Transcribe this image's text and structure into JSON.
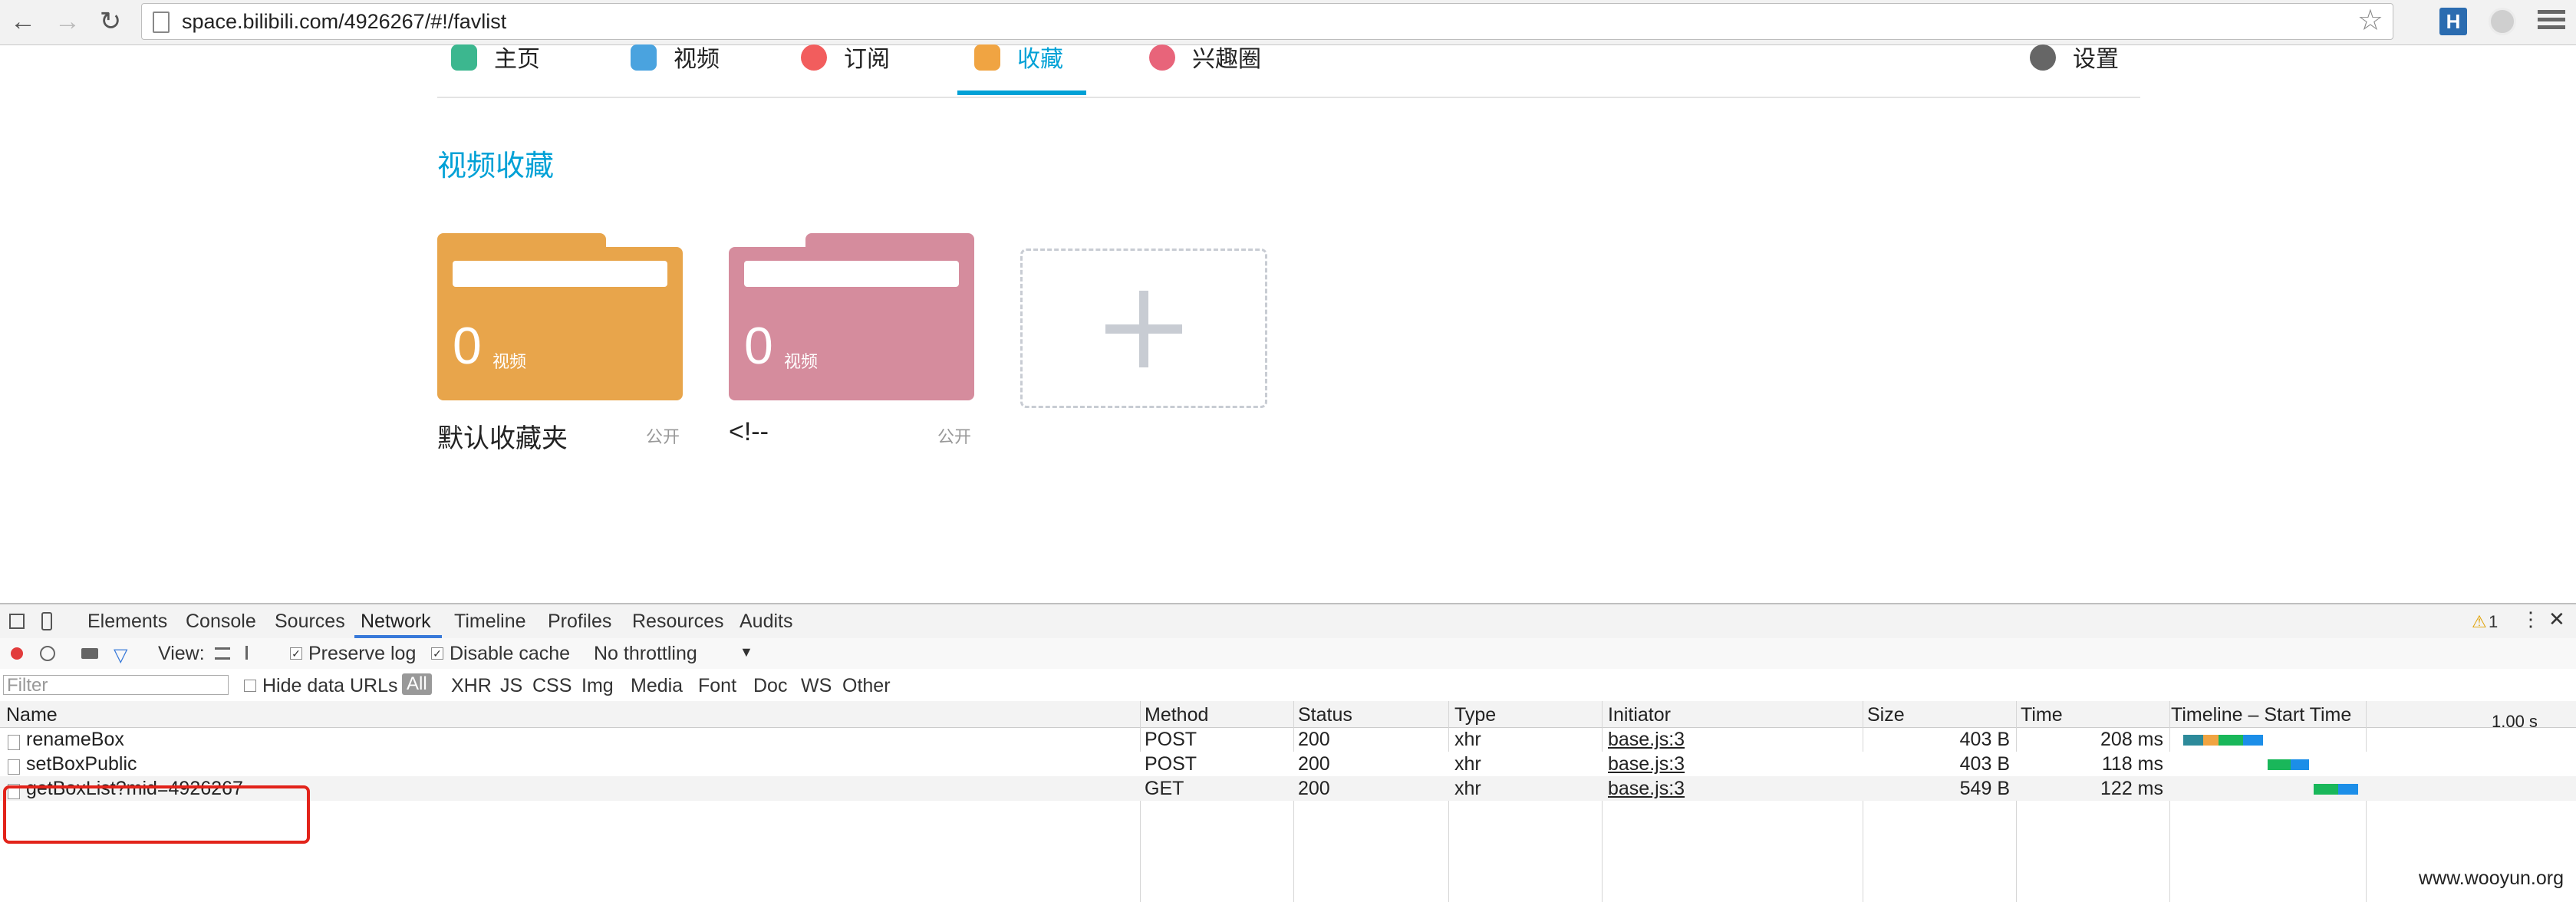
{
  "browser": {
    "url": "space.bilibili.com/4926267/#!/favlist",
    "back_icon": "arrow-left",
    "forward_icon": "arrow-right",
    "reload_icon": "reload",
    "ext_label": "H"
  },
  "nav": {
    "tabs": [
      {
        "label": "主页",
        "color": "#3cb78f"
      },
      {
        "label": "视频",
        "color": "#4aa3df"
      },
      {
        "label": "订阅",
        "color": "#f25d5d"
      },
      {
        "label": "收藏",
        "color": "#f0a442",
        "active": true
      },
      {
        "label": "兴趣圈",
        "color": "#e8647a"
      },
      {
        "label": "设置",
        "color": "#666666"
      }
    ],
    "accent": "#00a1d6"
  },
  "section_title": "视频收藏",
  "folders": [
    {
      "count": "0",
      "unit": "视频",
      "name": "默认收藏夹",
      "privacy": "公开",
      "color": "#e8a54b"
    },
    {
      "count": "0",
      "unit": "视频",
      "name": "<!--",
      "privacy": "公开",
      "color": "#d58c9d"
    }
  ],
  "devtools": {
    "tabs": [
      "Elements",
      "Console",
      "Sources",
      "Network",
      "Timeline",
      "Profiles",
      "Resources",
      "Audits"
    ],
    "active_tab": "Network",
    "warning_count": "1",
    "toolbar": {
      "view_label": "View:",
      "preserve_log": "Preserve log",
      "disable_cache": "Disable cache",
      "throttling": "No throttling"
    },
    "filter": {
      "placeholder": "Filter",
      "hide_data_urls": "Hide data URLs",
      "types": [
        "All",
        "XHR",
        "JS",
        "CSS",
        "Img",
        "Media",
        "Font",
        "Doc",
        "WS",
        "Other"
      ]
    },
    "columns": [
      "Name",
      "Method",
      "Status",
      "Type",
      "Initiator",
      "Size",
      "Time",
      "Timeline – Start Time",
      "1.00 s"
    ],
    "rows": [
      {
        "name": "renameBox",
        "method": "POST",
        "status": "200",
        "type": "xhr",
        "initiator": "base.js:3",
        "size": "403 B",
        "time": "208 ms"
      },
      {
        "name": "setBoxPublic",
        "method": "POST",
        "status": "200",
        "type": "xhr",
        "initiator": "base.js:3",
        "size": "403 B",
        "time": "118 ms"
      },
      {
        "name": "getBoxList?mid=4926267",
        "method": "GET",
        "status": "200",
        "type": "xhr",
        "initiator": "base.js:3",
        "size": "549 B",
        "time": "122 ms"
      }
    ]
  },
  "watermark": "www.wooyun.org"
}
